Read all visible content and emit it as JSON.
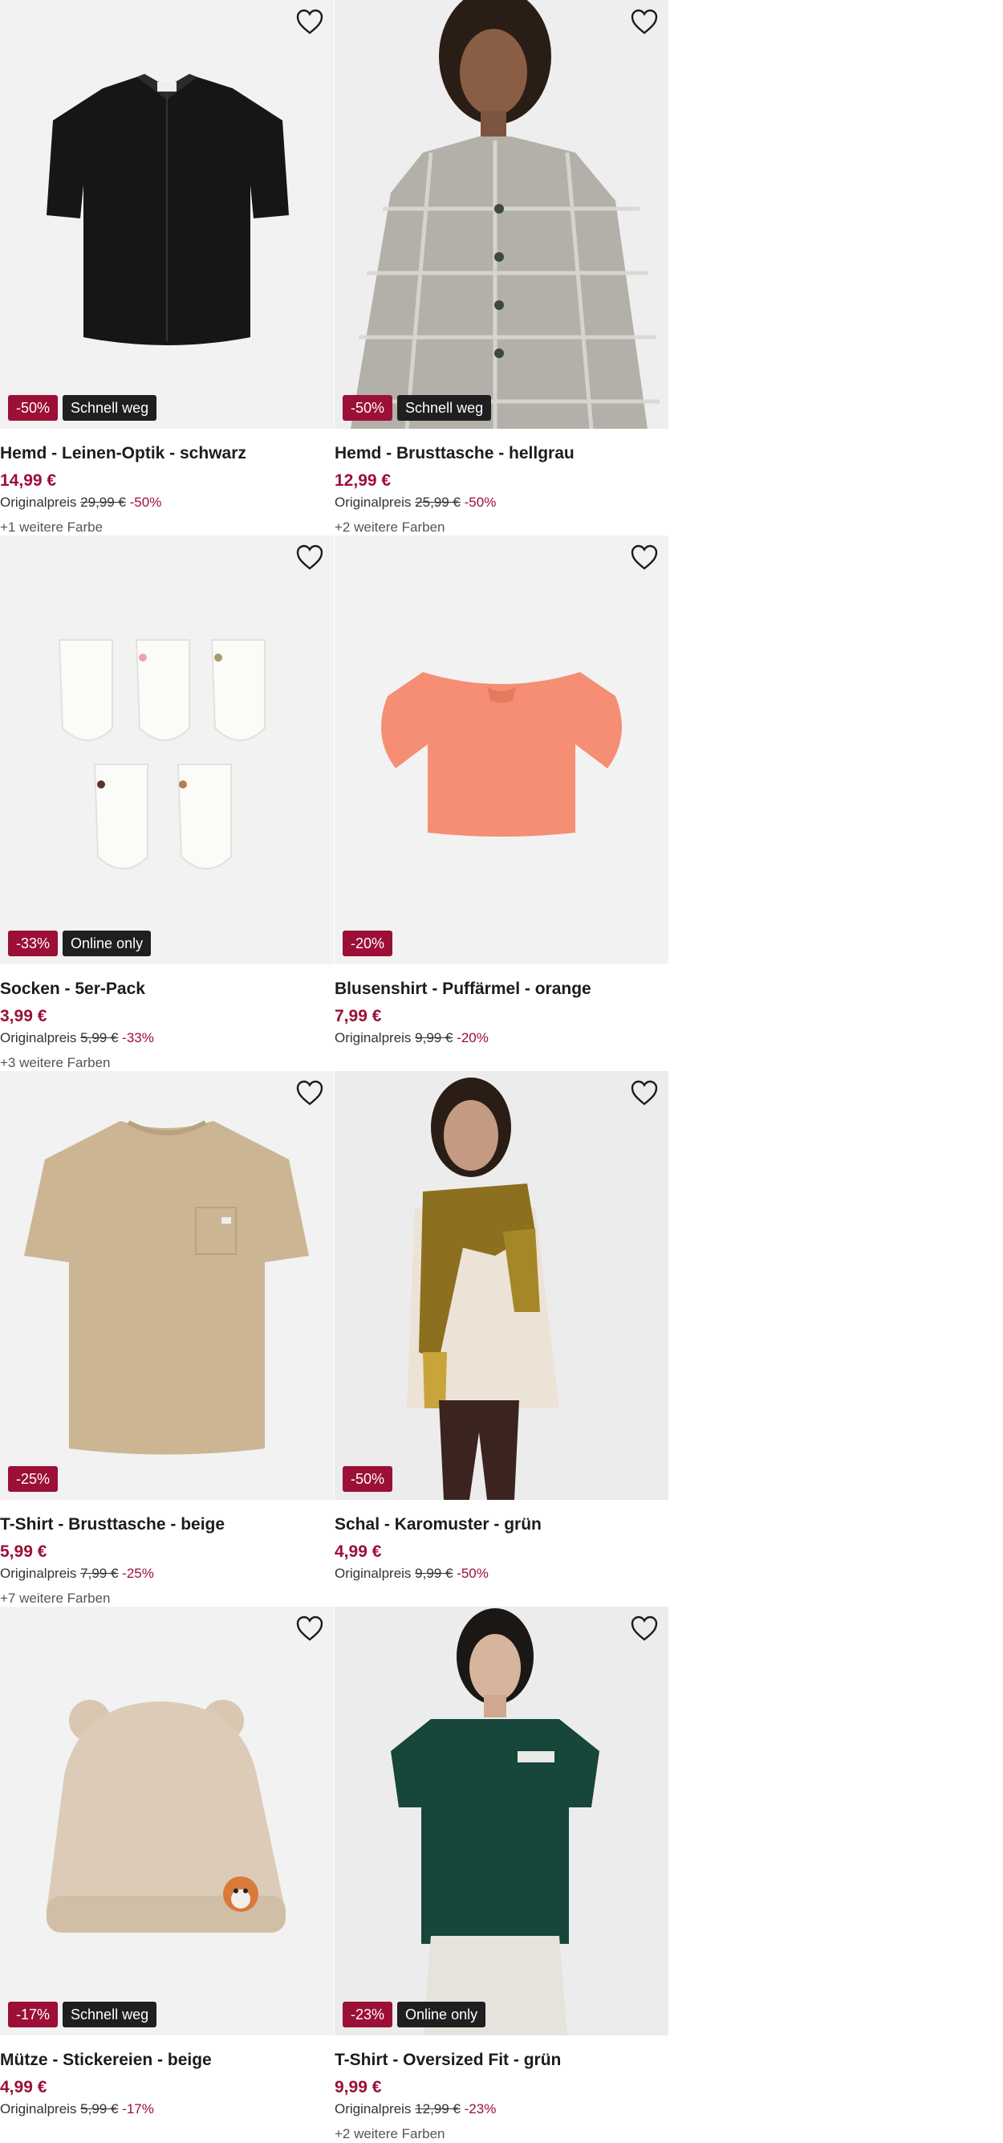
{
  "accent_color": "#9c0f36",
  "products": [
    {
      "name": "Hemd - Leinen-Optik - schwarz",
      "price": "14,99 €",
      "orig_label": "Originalpreis",
      "orig_price": "29,99 €",
      "orig_pct": "-50%",
      "discount": "-50%",
      "flag": "Schnell weg",
      "colors": "+1 weitere Farbe",
      "image": "black-shirt"
    },
    {
      "name": "Hemd - Brusttasche - hellgrau",
      "price": "12,99 €",
      "orig_label": "Originalpreis",
      "orig_price": "25,99 €",
      "orig_pct": "-50%",
      "discount": "-50%",
      "flag": "Schnell weg",
      "colors": "+2 weitere Farben",
      "image": "plaid-shirt-model"
    },
    {
      "name": "Socken - 5er-Pack",
      "price": "3,99 €",
      "orig_label": "Originalpreis",
      "orig_price": "5,99 €",
      "orig_pct": "-33%",
      "discount": "-33%",
      "flag": "Online only",
      "colors": "+3 weitere Farben",
      "image": "socks"
    },
    {
      "name": "Blusenshirt - Puffärmel - orange",
      "price": "7,99 €",
      "orig_label": "Originalpreis",
      "orig_price": "9,99 €",
      "orig_pct": "-20%",
      "discount": "-20%",
      "flag": "",
      "colors": "",
      "image": "orange-top"
    },
    {
      "name": "T-Shirt - Brusttasche - beige",
      "price": "5,99 €",
      "orig_label": "Originalpreis",
      "orig_price": "7,99 €",
      "orig_pct": "-25%",
      "discount": "-25%",
      "flag": "",
      "colors": "+7 weitere Farben",
      "image": "beige-tshirt"
    },
    {
      "name": "Schal - Karomuster - grün",
      "price": "4,99 €",
      "orig_label": "Originalpreis",
      "orig_price": "9,99 €",
      "orig_pct": "-50%",
      "discount": "-50%",
      "flag": "",
      "colors": "",
      "image": "scarf-model"
    },
    {
      "name": "Mütze - Stickereien - beige",
      "price": "4,99 €",
      "orig_label": "Originalpreis",
      "orig_price": "5,99 €",
      "orig_pct": "-17%",
      "discount": "-17%",
      "flag": "Schnell weg",
      "colors": "",
      "image": "knit-hat"
    },
    {
      "name": "T-Shirt - Oversized Fit - grün",
      "price": "9,99 €",
      "orig_label": "Originalpreis",
      "orig_price": "12,99 €",
      "orig_pct": "-23%",
      "discount": "-23%",
      "flag": "Online only",
      "colors": "+2 weitere Farben",
      "image": "green-tshirt-model"
    }
  ]
}
